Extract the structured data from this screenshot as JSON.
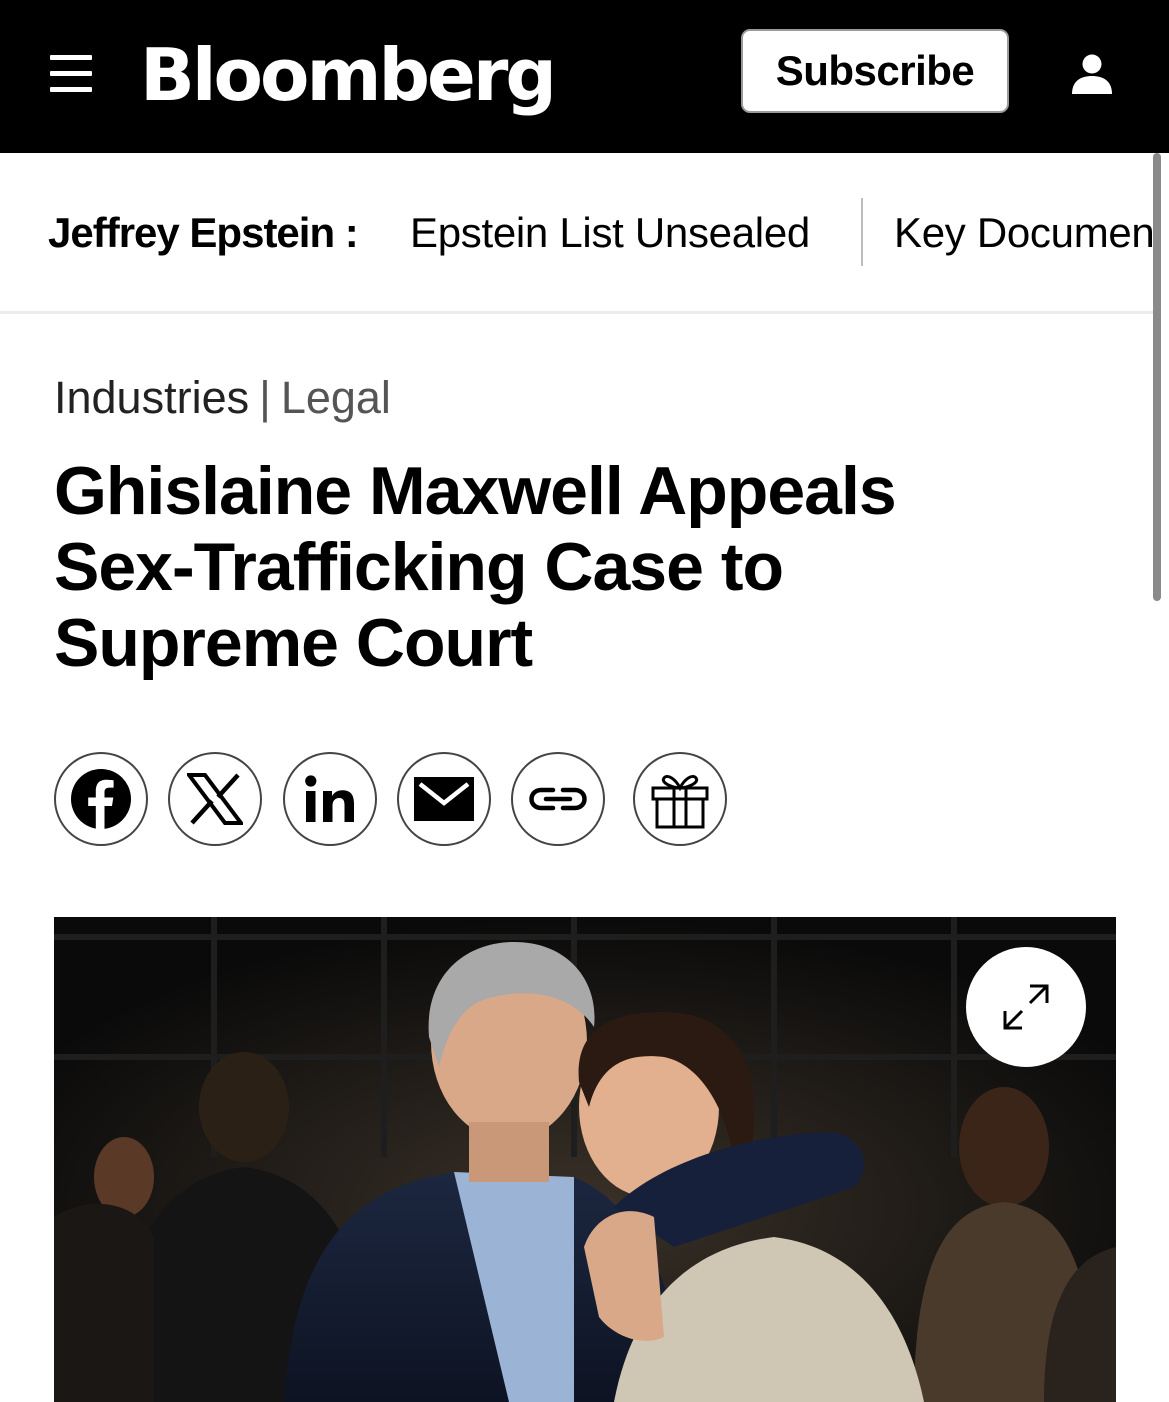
{
  "header": {
    "logo": "Bloomberg",
    "subscribe_label": "Subscribe",
    "icons": {
      "menu": "hamburger-menu-icon",
      "account": "user-account-icon"
    }
  },
  "topic_strip": {
    "label": "Jeffrey Epstein :",
    "links": [
      "Epstein List Unsealed",
      "Key Documen"
    ]
  },
  "breadcrumb": {
    "section": "Industries",
    "separator": "|",
    "subsection": "Legal"
  },
  "article": {
    "headline_lines": [
      "Ghislaine Maxwell Appeals",
      "Sex-Trafficking Case to",
      "Supreme Court"
    ]
  },
  "share": {
    "icons": [
      "facebook-icon",
      "x-icon",
      "linkedin-icon",
      "email-icon",
      "copy-link-icon",
      "gift-icon"
    ]
  },
  "hero": {
    "icon": "expand-icon"
  },
  "colors": {
    "header_bg": "#000000",
    "page_bg": "#ffffff",
    "divider": "#bdbdbd"
  }
}
